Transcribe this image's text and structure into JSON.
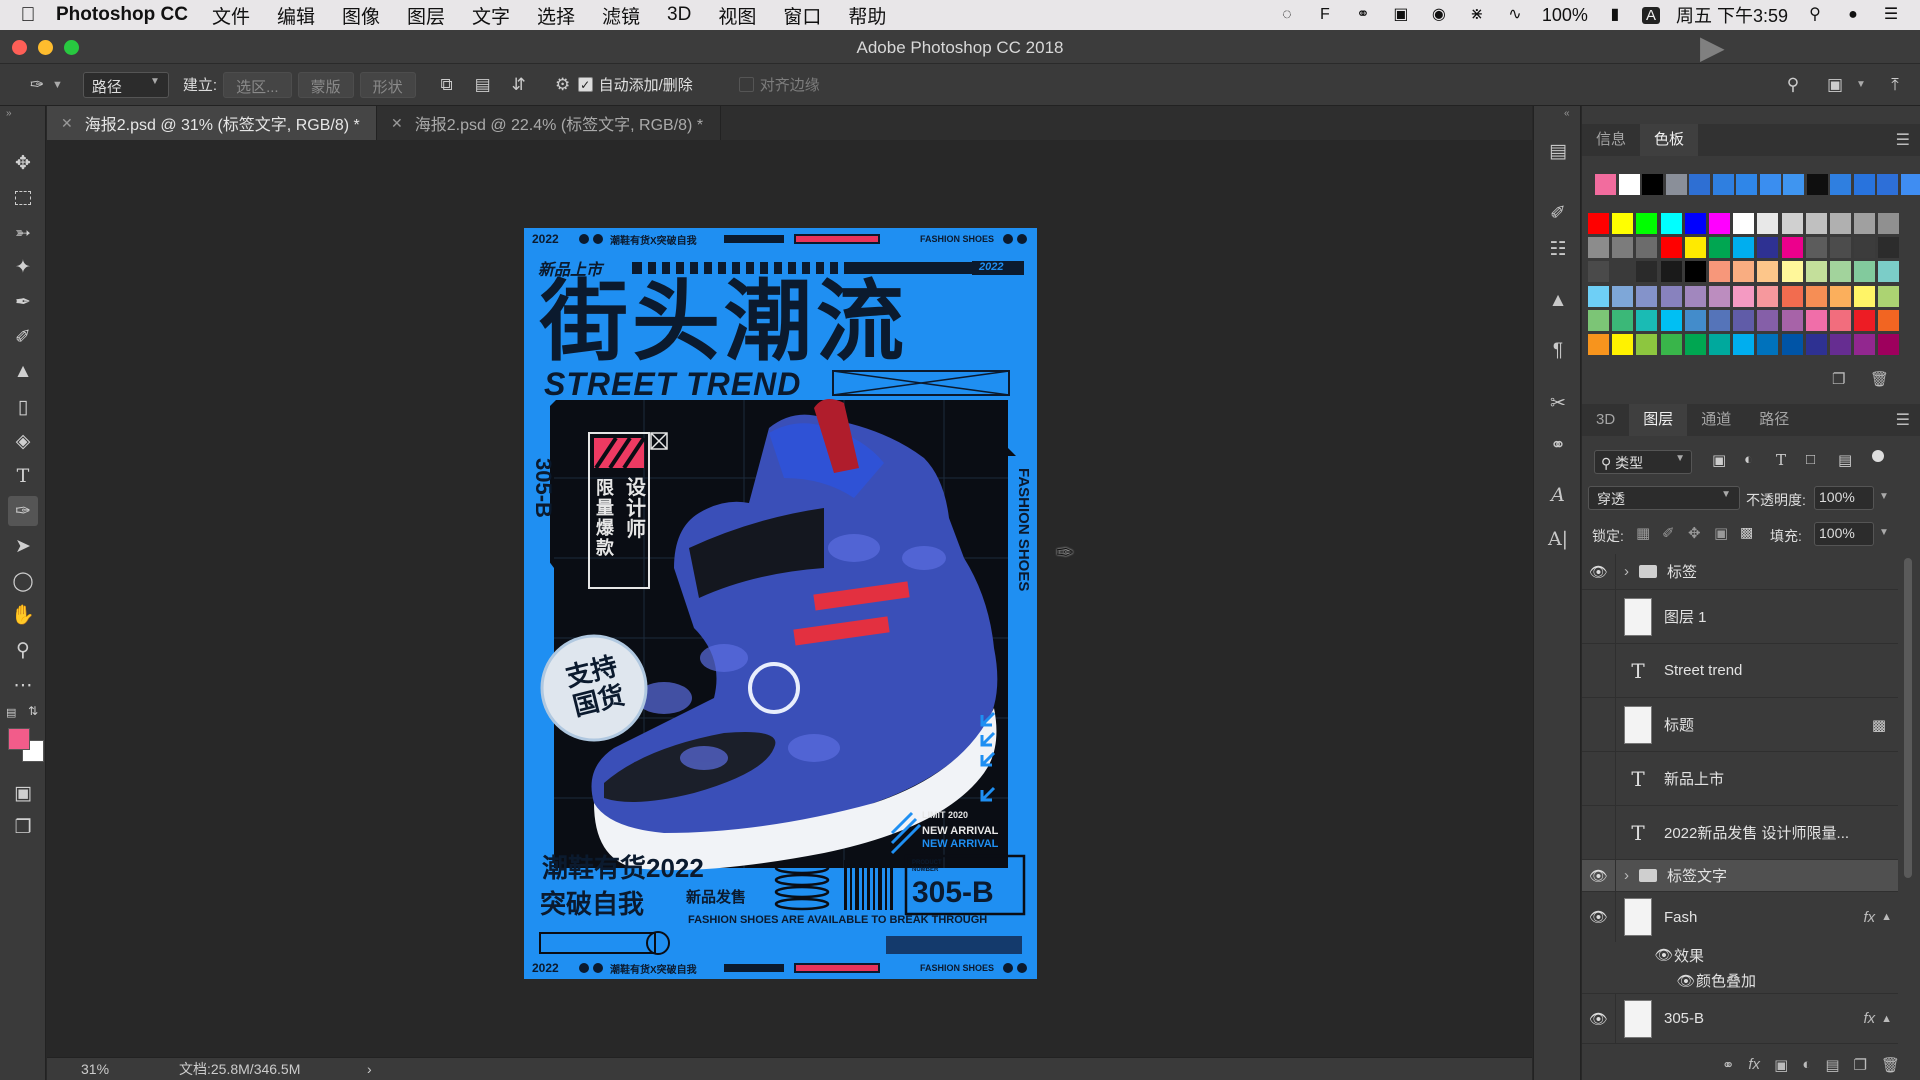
{
  "menubar": {
    "app_name": "Photoshop CC",
    "items": [
      "文件",
      "编辑",
      "图像",
      "图层",
      "文字",
      "选择",
      "滤镜",
      "3D",
      "视图",
      "窗口",
      "帮助"
    ],
    "battery": "100%",
    "input_method": "A",
    "clock": "周五 下午3:59"
  },
  "window": {
    "title": "Adobe Photoshop CC 2018"
  },
  "options": {
    "mode_value": "路径",
    "make_label": "建立:",
    "selection_btn": "选区...",
    "mask_btn": "蒙版",
    "shape_btn": "形状",
    "auto_add_label": "自动添加/删除",
    "align_edges_label": "对齐边缘"
  },
  "tabs": [
    {
      "label": "海报2.psd @ 31% (标签文字, RGB/8) *"
    },
    {
      "label": "海报2.psd @ 22.4% (标签文字, RGB/8) *"
    }
  ],
  "poster": {
    "top_year": "2022",
    "top_slogan": "潮鞋有货X突破自我",
    "top_right": "FASHION SHOES",
    "new_label": "新品上市",
    "year_tag": "2022",
    "main_title": "街头潮流",
    "subtitle": "STREET TREND",
    "side_left": "305-B",
    "side_right": "FASHION SHOES",
    "badge_designer": "设计师",
    "badge_limited": "限量爆款",
    "sticker": "支持国货",
    "limit_text": "LIMIT 2020",
    "new_arrival_1": "NEW ARRIVAL",
    "new_arrival_2": "NEW ARRIVAL",
    "bottom_title": "潮鞋有货2022",
    "bottom_release": "新品发售",
    "bottom_break": "突破自我",
    "product_number_label": "PRODUCT NUMBER",
    "product_code": "305-B",
    "tagline": "FASHION SHOES ARE AVAILABLE TO BREAK THROUGH",
    "footer_year": "2022",
    "footer_slogan": "潮鞋有货X突破自我",
    "footer_right": "FASHION SHOES"
  },
  "status": {
    "zoom": "31%",
    "doc": "文档:25.8M/346.5M"
  },
  "swatch_panel": {
    "tabs": [
      "信息",
      "色板"
    ],
    "recent": [
      "#f26c9e",
      "#ffffff",
      "#000000",
      "#8a8f99",
      "#2e6fd3",
      "#2f7fe0",
      "#2f86e8",
      "#3a8ef0",
      "#3f95f0",
      "#0f0f0f",
      "#2f7fe0",
      "#2873dd",
      "#2d6fd8",
      "#3f8df2"
    ],
    "grid": [
      [
        "#ff0000",
        "#ffff00",
        "#00ff00",
        "#00ffff",
        "#0000ff",
        "#ff00ff",
        "#ffffff",
        "#e8e8e8",
        "#d0d0d0",
        "#c0c0c0",
        "#b0b0b0",
        "#a0a0a0",
        "#909090"
      ],
      [
        "#8c8c8c",
        "#7c7c7c",
        "#6c6c6c",
        "#ff0000",
        "#ffea00",
        "#00a651",
        "#00aeef",
        "#2e3192",
        "#ec008c",
        "#5c5c5c",
        "#4c4c4c",
        "#3c3c3c",
        "#2c2c2c"
      ],
      [
        "#4a4a4a",
        "#3a3a3a",
        "#2a2a2a",
        "#1a1a1a",
        "#000000",
        "#f7977a",
        "#f9ad81",
        "#fdc68a",
        "#fff79a",
        "#c4df9b",
        "#a2d39c",
        "#82ca9d",
        "#7bcdc8"
      ],
      [
        "#6ecff6",
        "#7ea7d8",
        "#8493ca",
        "#8882be",
        "#a187be",
        "#bc8dbf",
        "#f49ac2",
        "#f6989d",
        "#f26c4f",
        "#f68e55",
        "#fbaf5c",
        "#fff467",
        "#acd372"
      ],
      [
        "#7cc576",
        "#3bb878",
        "#1abbb4",
        "#00bff3",
        "#438ccb",
        "#5574b9",
        "#605ca8",
        "#855fa8",
        "#a763a8",
        "#f06ea9",
        "#f26d7d",
        "#ed1c24",
        "#f26522"
      ],
      [
        "#f7941d",
        "#fff200",
        "#8dc63f",
        "#39b54a",
        "#00a651",
        "#00a99d",
        "#00aeef",
        "#0072bc",
        "#0054a6",
        "#2e3192",
        "#662d91",
        "#92278f",
        "#9e005d"
      ]
    ]
  },
  "layers_panel": {
    "tabs": [
      "3D",
      "图层",
      "通道",
      "路径"
    ],
    "filter_label": "类型",
    "blend_mode": "穿透",
    "opacity_label": "不透明度:",
    "opacity_value": "100%",
    "lock_label": "锁定:",
    "fill_label": "填充:",
    "fill_value": "100%",
    "layers": [
      {
        "name": "标签",
        "kind": "group",
        "visible": true
      },
      {
        "name": "图层 1",
        "kind": "pixel",
        "visible": false
      },
      {
        "name": "Street trend",
        "kind": "text",
        "visible": false
      },
      {
        "name": "标题",
        "kind": "pixel",
        "visible": false,
        "locked": true
      },
      {
        "name": "新品上市",
        "kind": "text",
        "visible": false
      },
      {
        "name": "2022新品发售 设计师限量...",
        "kind": "text",
        "visible": false
      },
      {
        "name": "标签文字",
        "kind": "group",
        "visible": true,
        "selected": true
      },
      {
        "name": "Fash",
        "kind": "smart",
        "visible": true,
        "fx": true
      },
      {
        "name": "效果",
        "kind": "effect",
        "visible": true
      },
      {
        "name": "颜色叠加",
        "kind": "effect-item",
        "visible": true
      },
      {
        "name": "305-B",
        "kind": "smart",
        "visible": true,
        "fx": true
      }
    ],
    "fx_label": "fx"
  },
  "icons": {
    "toolbar": [
      "move-icon",
      "marquee-icon",
      "lasso-icon",
      "magic-wand-icon",
      "eyedropper-icon",
      "brush-icon",
      "stamp-icon",
      "eraser-icon",
      "paint-bucket-icon",
      "type-icon",
      "pen-icon",
      "path-select-icon",
      "ellipse-icon",
      "hand-icon",
      "zoom-icon",
      "more-icon"
    ]
  },
  "colors": {
    "poster_blue": "#1f8ff2",
    "foreground": "#f25c8a",
    "background": "#ffffff"
  }
}
